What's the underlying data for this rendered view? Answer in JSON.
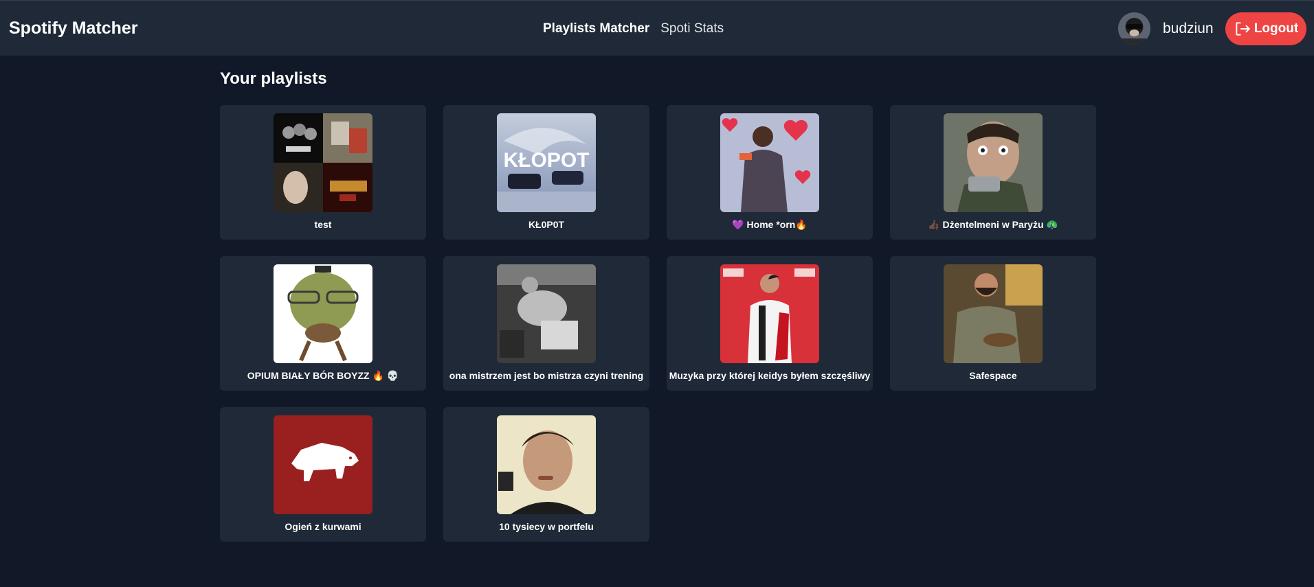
{
  "header": {
    "app_title": "Spotify Matcher",
    "nav": [
      {
        "label": "Playlists Matcher",
        "active": true
      },
      {
        "label": "Spoti Stats",
        "active": false
      }
    ],
    "user": {
      "name": "budziun",
      "avatar_icon": "user-avatar"
    },
    "logout_label": "Logout",
    "logout_icon": "logout-icon"
  },
  "main": {
    "title": "Your playlists",
    "playlists": [
      {
        "name": "test"
      },
      {
        "name": "KŁ0P0T"
      },
      {
        "name": "💜 Home *orn🔥"
      },
      {
        "name": "👍🏿 Dżentelmeni w Paryżu 🦚"
      },
      {
        "name": "OPIUM BIAŁY BÓR BOYZZ 🔥 💀"
      },
      {
        "name": "ona mistrzem jest bo mistrza czyni trening"
      },
      {
        "name": "Muzyka przy której keidys byłem szczęśliwy"
      },
      {
        "name": "Safespace"
      },
      {
        "name": "Ogień z kurwami"
      },
      {
        "name": "10 tysiecy w portfelu"
      }
    ]
  },
  "colors": {
    "background": "#111827",
    "topbar": "#1f2937",
    "card": "#1f2937",
    "logout_button": "#ef4444"
  }
}
